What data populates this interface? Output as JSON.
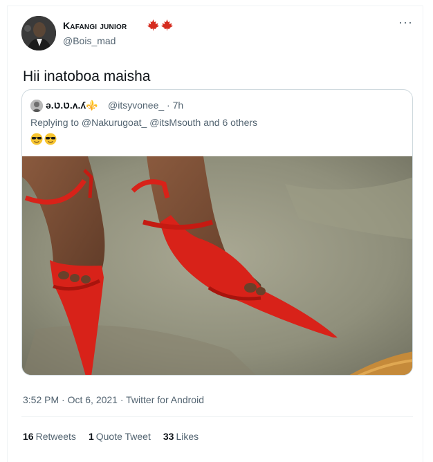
{
  "tweet": {
    "author_name": "Kafangi junior",
    "author_handle": "@Bois_mad",
    "text": "Hii inatoboa maisha",
    "timestamp": "3:52 PM · Oct 6, 2021 · Twitter for Android",
    "more_icon": "ellipsis-icon"
  },
  "quote": {
    "author_name": "ə.ט.ט.ʌ.ʎ⚜️",
    "author_handle": "@itsyvonee_ · 7h",
    "replying_to": "Replying to @Nakurugoat_ @itsMsouth and 6 others",
    "emoji": "😎😎"
  },
  "stats": {
    "retweets_count": "16",
    "retweets_label": "Retweets",
    "quotes_count": "1",
    "quotes_label": "Quote Tweet",
    "likes_count": "33",
    "likes_label": "Likes"
  },
  "colors": {
    "text": "#0f1419",
    "secondary": "#536471",
    "border": "#cfd9de",
    "flag_red": "#d52b1e"
  }
}
